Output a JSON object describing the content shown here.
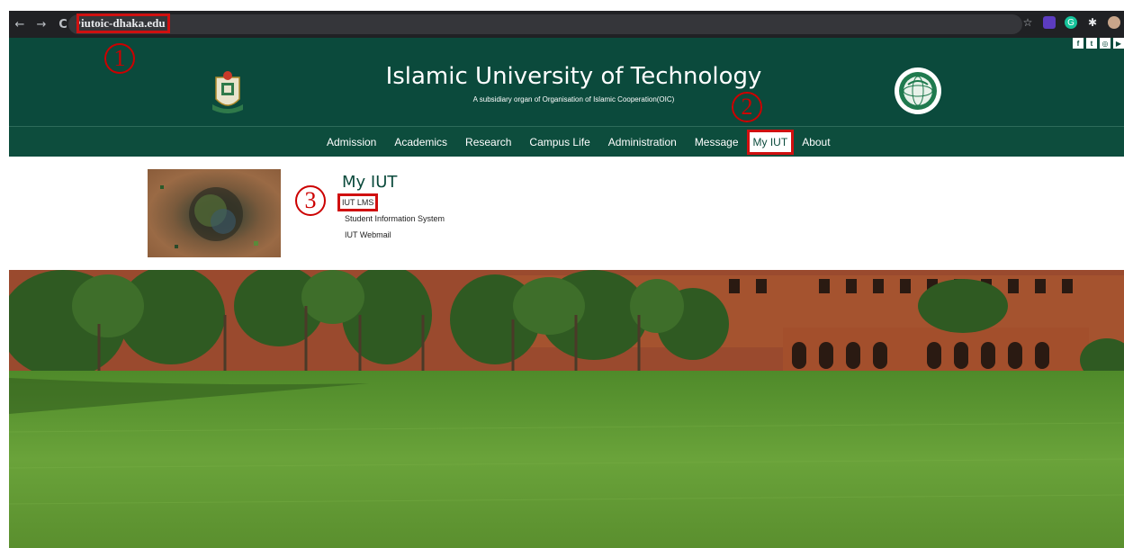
{
  "browser": {
    "url": "iutoic-dhaka.edu",
    "back": "←",
    "forward": "→",
    "reload": "C"
  },
  "social": [
    "f",
    "t",
    "◎",
    "▶"
  ],
  "header": {
    "title": "Islamic University of Technology",
    "subtitle": "A subsidiary organ of Organisation of Islamic Cooperation(OIC)"
  },
  "nav": {
    "items": [
      "Admission",
      "Academics",
      "Research",
      "Campus Life",
      "Administration",
      "Message",
      "My IUT",
      "About"
    ]
  },
  "dropdown": {
    "title": "My IUT",
    "links": [
      "IUT LMS",
      "Student Information System",
      "IUT Webmail"
    ]
  },
  "markers": [
    "1",
    "2",
    "3"
  ],
  "colors": {
    "brand_green": "#0b4a3c",
    "highlight_red": "#d01010"
  }
}
